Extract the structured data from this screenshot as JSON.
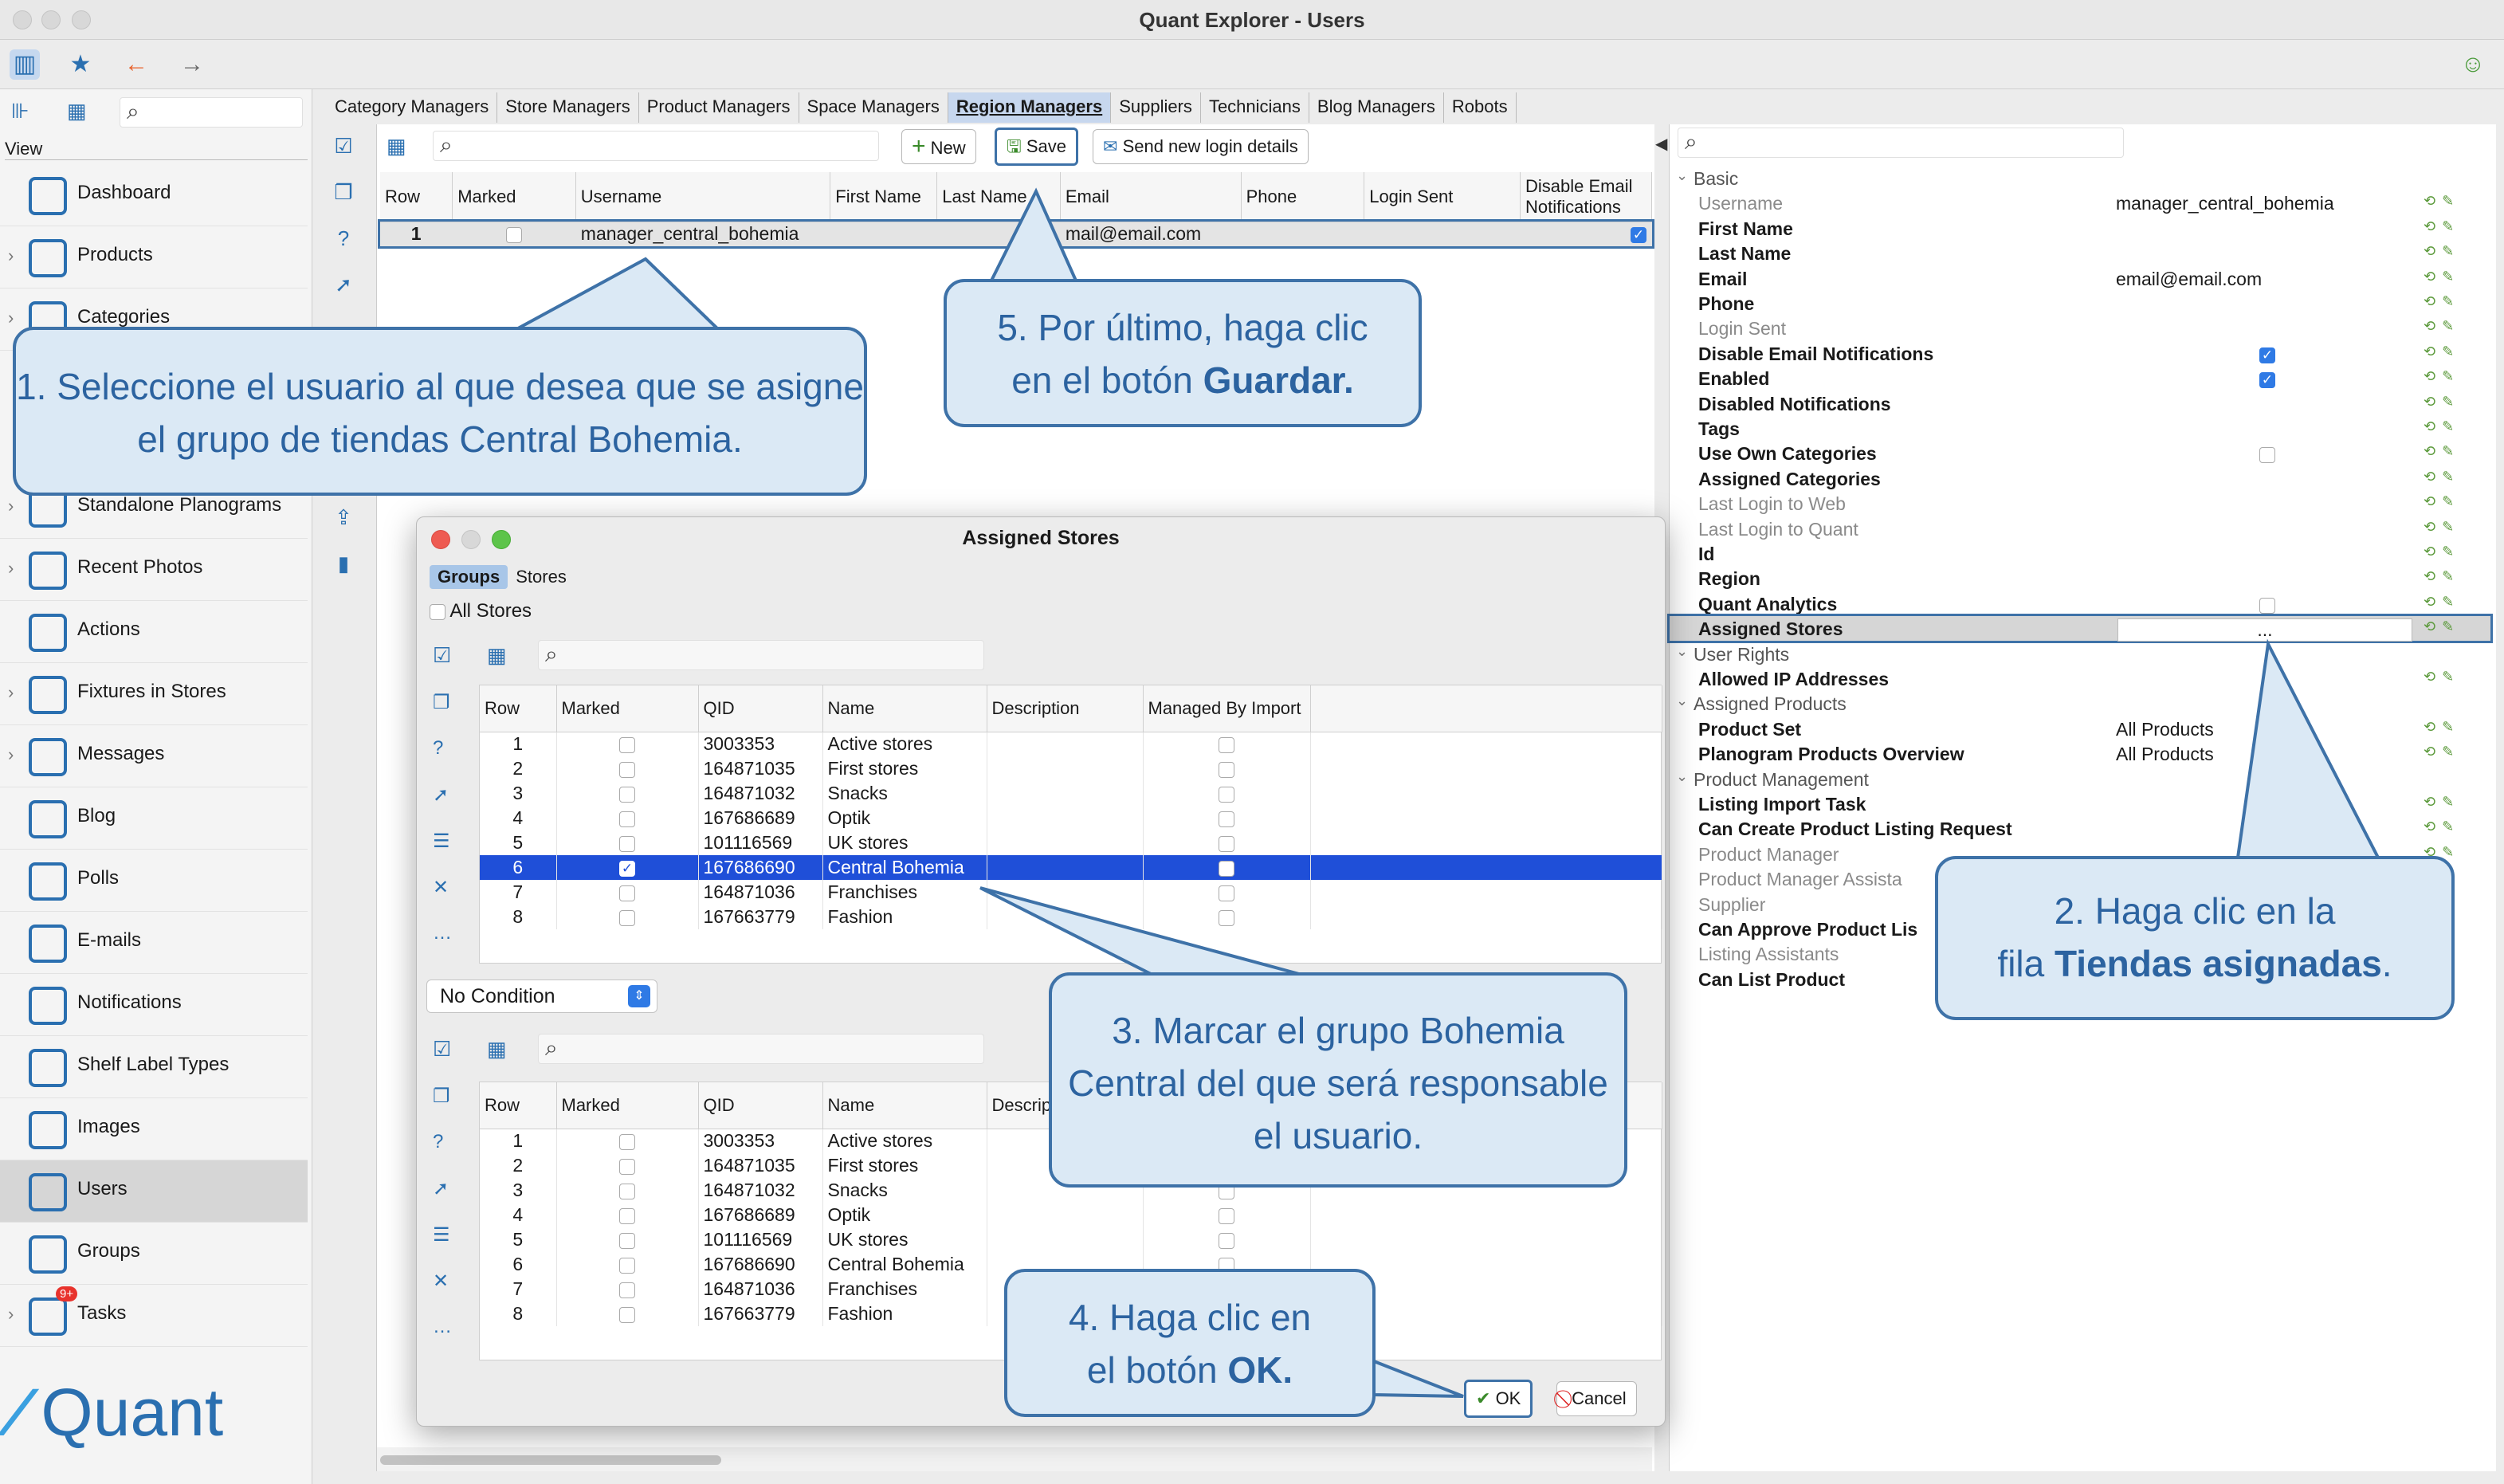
{
  "window": {
    "title": "Quant Explorer - Users"
  },
  "sidebar": {
    "view_label": "View",
    "items": [
      {
        "label": "Dashboard"
      },
      {
        "label": "Products"
      },
      {
        "label": "Categories"
      },
      {
        "label": "Standalone Planograms"
      },
      {
        "label": "Recent Photos"
      },
      {
        "label": "Actions"
      },
      {
        "label": "Fixtures in Stores"
      },
      {
        "label": "Messages"
      },
      {
        "label": "Blog"
      },
      {
        "label": "Polls"
      },
      {
        "label": "E-mails"
      },
      {
        "label": "Notifications"
      },
      {
        "label": "Shelf Label Types"
      },
      {
        "label": "Images"
      },
      {
        "label": "Users"
      },
      {
        "label": "Groups"
      },
      {
        "label": "Tasks"
      }
    ],
    "tasks_badge": "9+",
    "logo": "Quant"
  },
  "tabs": [
    "Category Managers",
    "Store Managers",
    "Product Managers",
    "Space Managers",
    "Region Managers",
    "Suppliers",
    "Technicians",
    "Blog Managers",
    "Robots"
  ],
  "toolbar": {
    "new": "New",
    "save": "Save",
    "send": "Send new login details"
  },
  "users_table": {
    "headers": [
      "Row",
      "Marked",
      "Username",
      "First Name",
      "Last Name",
      "Email",
      "Phone",
      "Login Sent",
      "Disable Email Notifications"
    ],
    "row": {
      "row": "1",
      "username": "manager_central_bohemia",
      "email": "mail@email.com"
    }
  },
  "properties": {
    "rows": [
      {
        "label": "Basic",
        "type": "cat"
      },
      {
        "label": "Username",
        "value": "manager_central_bohemia",
        "dim": true
      },
      {
        "label": "First Name",
        "value": ""
      },
      {
        "label": "Last Name",
        "value": ""
      },
      {
        "label": "Email",
        "value": "email@email.com"
      },
      {
        "label": "Phone",
        "value": ""
      },
      {
        "label": "Login Sent",
        "value": "",
        "dim": true
      },
      {
        "label": "Disable Email Notifications",
        "check": true
      },
      {
        "label": "Enabled",
        "check": true
      },
      {
        "label": "Disabled Notifications",
        "value": ""
      },
      {
        "label": "Tags",
        "value": ""
      },
      {
        "label": "Use Own Categories",
        "check": false
      },
      {
        "label": "Assigned Categories",
        "value": ""
      },
      {
        "label": "Last Login to Web",
        "value": "",
        "dim": true
      },
      {
        "label": "Last Login to Quant",
        "value": "",
        "dim": true
      },
      {
        "label": "Id",
        "value": ""
      },
      {
        "label": "Region",
        "value": ""
      },
      {
        "label": "Quant Analytics",
        "check": false
      },
      {
        "label": "Assigned Stores",
        "value": "...",
        "sel": true
      },
      {
        "label": "User Rights",
        "type": "cat"
      },
      {
        "label": "Allowed IP Addresses",
        "value": ""
      },
      {
        "label": "Assigned Products",
        "type": "cat"
      },
      {
        "label": "Product Set",
        "value": "All Products"
      },
      {
        "label": "Planogram Products Overview",
        "value": "All Products"
      },
      {
        "label": "Product Management",
        "type": "cat"
      },
      {
        "label": "Listing Import Task",
        "value": ""
      },
      {
        "label": "Can Create Product Listing Request",
        "value": ""
      },
      {
        "label": "Product Manager",
        "value": "",
        "dim": true
      },
      {
        "label": "Product Manager Assista",
        "value": "",
        "dim": true
      },
      {
        "label": "Supplier",
        "value": "",
        "dim": true
      },
      {
        "label": "Can Approve Product Lis",
        "value": ""
      },
      {
        "label": "Listing Assistants",
        "value": "",
        "dim": true
      },
      {
        "label": "Can List Product",
        "value": ""
      }
    ]
  },
  "dialog": {
    "title": "Assigned Stores",
    "tabs": [
      "Groups",
      "Stores"
    ],
    "all_stores": "All Stores",
    "condition": "No Condition",
    "ok": "OK",
    "cancel": "Cancel",
    "headers": [
      "Row",
      "Marked",
      "QID",
      "Name",
      "Description",
      "Managed By Import"
    ],
    "rows": [
      {
        "row": "1",
        "qid": "3003353",
        "name": "Active stores"
      },
      {
        "row": "2",
        "qid": "164871035",
        "name": "First stores"
      },
      {
        "row": "3",
        "qid": "164871032",
        "name": "Snacks"
      },
      {
        "row": "4",
        "qid": "167686689",
        "name": "Optik"
      },
      {
        "row": "5",
        "qid": "101116569",
        "name": "UK stores"
      },
      {
        "row": "6",
        "qid": "167686690",
        "name": "Central Bohemia"
      },
      {
        "row": "7",
        "qid": "164871036",
        "name": "Franchises"
      },
      {
        "row": "8",
        "qid": "167663779",
        "name": "Fashion"
      }
    ],
    "selected_row": "6"
  },
  "callouts": {
    "c1": "1. Seleccione el usuario al que desea que se asigne el grupo de tiendas Central Bohemia.",
    "c2a": "2. Haga clic en la",
    "c2b": "fila ",
    "c2c": "Tiendas asignadas",
    "c3": "3. Marcar el grupo Bohemia Central del que será responsable el usuario.",
    "c4a": "4. Haga clic en",
    "c4b": "el botón ",
    "c4c": "OK",
    "c5a": "5. Por último, haga clic",
    "c5b": "en el botón ",
    "c5c": "Guardar"
  },
  "colors": {
    "accent": "#2f7ae5",
    "selection": "#1f4fd8",
    "callout_border": "#3e72a8",
    "callout_fill": "#dbe9f5"
  }
}
